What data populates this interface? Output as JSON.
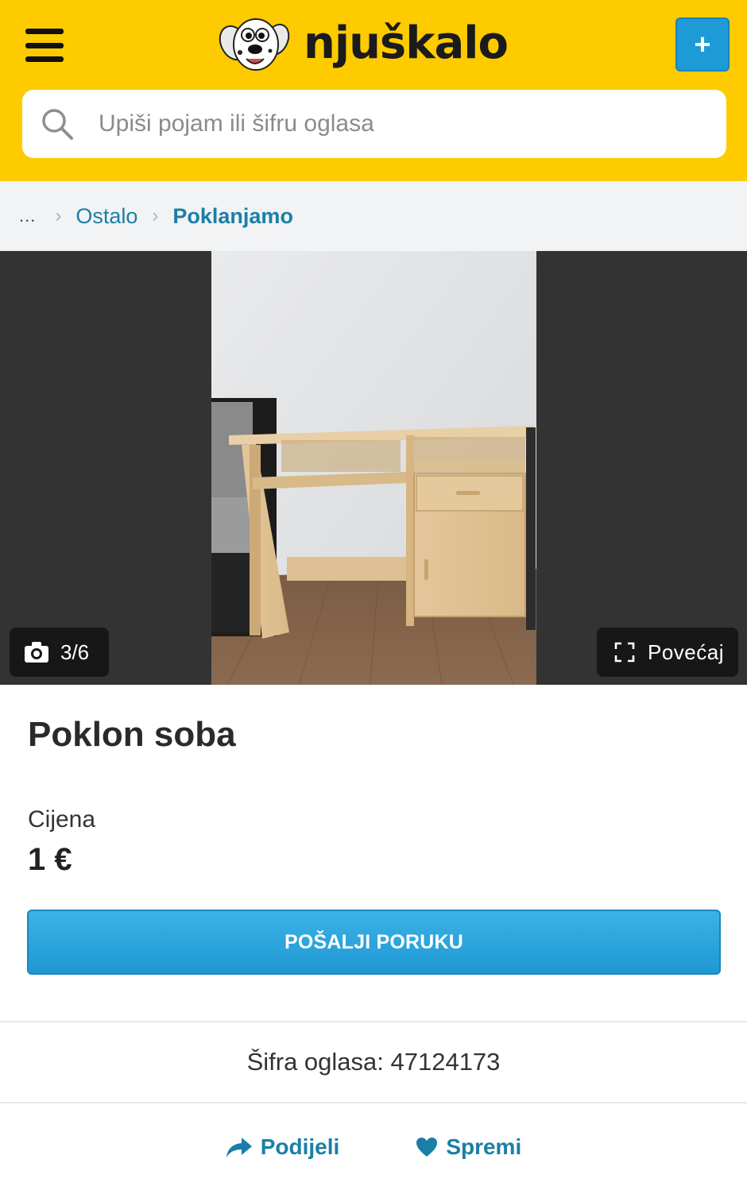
{
  "header": {
    "logo_text": "njuškalo",
    "post_button_label": "+",
    "background_color": "#fdcb00",
    "accent_color": "#1e9bd7"
  },
  "search": {
    "placeholder": "Upiši pojam ili šifru oglasa",
    "value": ""
  },
  "breadcrumb": {
    "ellipsis": "...",
    "items": [
      {
        "label": "Ostalo"
      },
      {
        "label": "Poklanjamo"
      }
    ]
  },
  "gallery": {
    "counter": "3/6",
    "zoom_label": "Povećaj",
    "current_image": 3,
    "total_images": 6,
    "icons": [
      "camera-icon",
      "expand-icon"
    ]
  },
  "listing": {
    "title": "Poklon soba",
    "price_label": "Cijena",
    "price_value": "1 €",
    "message_button_label": "POŠALJI PORUKU",
    "ad_code_text": "Šifra oglasa: 47124173"
  },
  "actions": {
    "share_label": "Podijeli",
    "save_label": "Spremi",
    "icons": [
      "share-icon",
      "heart-icon"
    ]
  }
}
